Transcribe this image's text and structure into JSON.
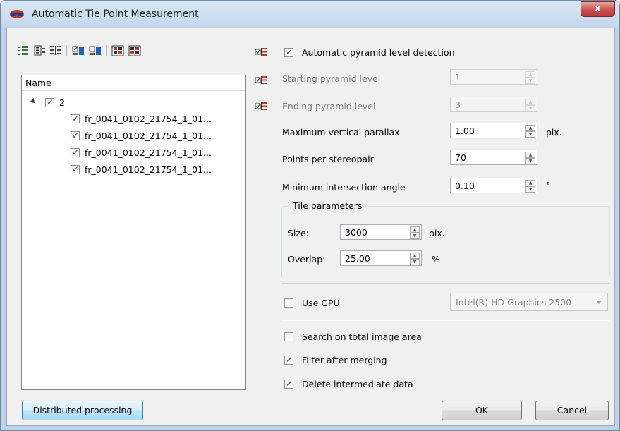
{
  "window": {
    "title": "Automatic Tie Point Measurement",
    "close_label": "x"
  },
  "toolbar": {
    "icons": [
      "expand-all-icon",
      "collapse-all-icon",
      "tree-view-icon",
      "check-all-icon",
      "uncheck-all-icon",
      "select-grid-icon",
      "deselect-grid-icon"
    ]
  },
  "tree": {
    "header": "Name",
    "root": {
      "label": "2",
      "checked": true
    },
    "items": [
      {
        "label": "fr_0041_0102_21754_1_01...",
        "checked": true
      },
      {
        "label": "fr_0041_0102_21754_1_01...",
        "checked": true
      },
      {
        "label": "fr_0041_0102_21754_1_01...",
        "checked": true
      },
      {
        "label": "fr_0041_0102_21754_1_01...",
        "checked": true
      }
    ]
  },
  "settings": {
    "auto_pyramid_label": "Automatic pyramid level detection",
    "auto_pyramid_checked": true,
    "starting_level_label": "Starting pyramid level",
    "starting_level_value": "1",
    "ending_level_label": "Ending pyramid level",
    "ending_level_value": "3",
    "max_parallax_label": "Maximum vertical parallax",
    "max_parallax_value": "1.00",
    "max_parallax_unit": "pix.",
    "points_label": "Points per stereopair",
    "points_value": "70",
    "min_angle_label": "Minimum intersection angle",
    "min_angle_value": "0.10",
    "min_angle_unit": "°"
  },
  "tile": {
    "group_title": "Tile parameters",
    "size_label": "Size:",
    "size_value": "3000",
    "size_unit": "pix.",
    "overlap_label": "Overlap:",
    "overlap_value": "25.00",
    "overlap_unit": "%"
  },
  "gpu": {
    "label": "Use GPU",
    "checked": false,
    "device": "Intel(R) HD Graphics 2500"
  },
  "options": {
    "search_total_label": "Search on total image area",
    "search_total_checked": false,
    "filter_label": "Filter after merging",
    "filter_checked": true,
    "delete_label": "Delete intermediate data",
    "delete_checked": true
  },
  "buttons": {
    "distributed": "Distributed processing",
    "ok": "OK",
    "cancel": "Cancel"
  }
}
